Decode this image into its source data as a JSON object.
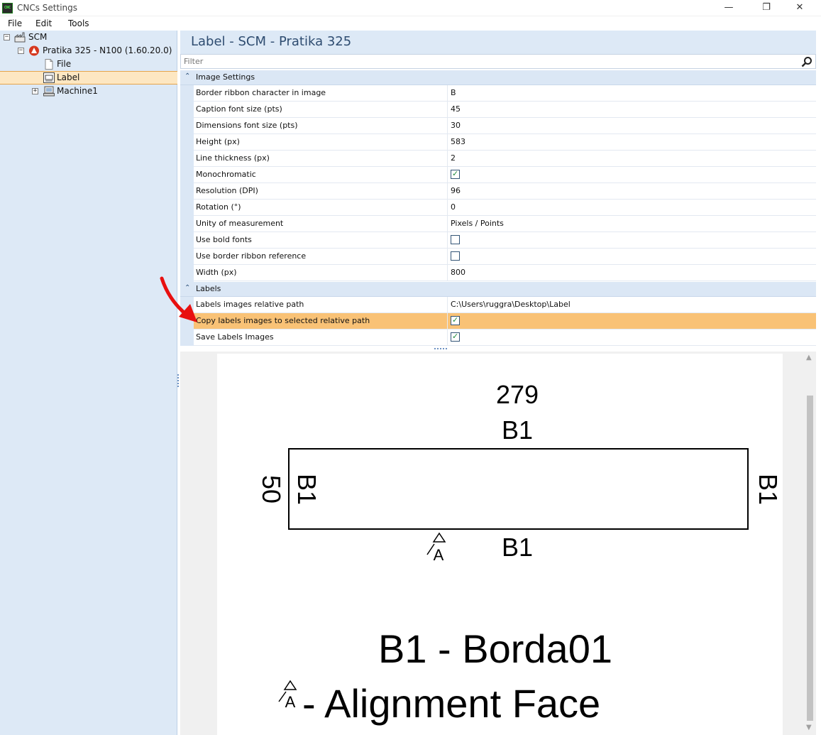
{
  "window": {
    "title": "CNCs Settings",
    "app_icon_text": "CNC",
    "minimize": "—",
    "restore": "❐",
    "close": "✕"
  },
  "menu": [
    "File",
    "Edit",
    "Tools"
  ],
  "tree": {
    "root": "SCM",
    "machine_model": "Pratika 325 - N100 (1.60.20.0)",
    "children": [
      "File",
      "Label",
      "Machine1"
    ],
    "selected": "Label"
  },
  "header": {
    "title": "Label - SCM - Pratika 325"
  },
  "filter": {
    "placeholder": "Filter",
    "value": ""
  },
  "image_settings": {
    "category": "Image Settings",
    "rows": [
      {
        "name": "Border ribbon character in image",
        "value": "B"
      },
      {
        "name": "Caption font size (pts)",
        "value": "45"
      },
      {
        "name": "Dimensions font size (pts)",
        "value": "30"
      },
      {
        "name": "Height (px)",
        "value": "583"
      },
      {
        "name": "Line thickness (px)",
        "value": "2"
      },
      {
        "name": "Monochromatic",
        "checked": true
      },
      {
        "name": "Resolution (DPI)",
        "value": "96"
      },
      {
        "name": "Rotation (°)",
        "value": "0"
      },
      {
        "name": "Unity of measurement",
        "value": "Pixels / Points"
      },
      {
        "name": "Use bold fonts",
        "checked": false
      },
      {
        "name": "Use border ribbon reference",
        "checked": false
      },
      {
        "name": "Width (px)",
        "value": "800"
      }
    ]
  },
  "labels": {
    "category": "Labels",
    "rows": [
      {
        "name": "Labels images relative path",
        "value": "C:\\Users\\ruggra\\Desktop\\Label"
      },
      {
        "name": "Copy labels images to selected relative path",
        "checked": true,
        "highlighted": true
      },
      {
        "name": "Save Labels Images",
        "checked": true
      }
    ]
  },
  "preview": {
    "top_dimension": "279",
    "left_dimension": "50",
    "edge_top": "B1",
    "edge_left": "B1",
    "edge_right": "B1",
    "edge_bottom": "B1",
    "alignment_marker": "A",
    "legend_edge": "B1 - Borda01",
    "legend_alignment": " - Alignment Face"
  },
  "colors": {
    "tree_bg": "#dde9f6",
    "header_title": "#2e4c70",
    "selected_row": "#f9c276",
    "check_tick": "#1e8a3c",
    "annotation_arrow": "#e81010"
  }
}
